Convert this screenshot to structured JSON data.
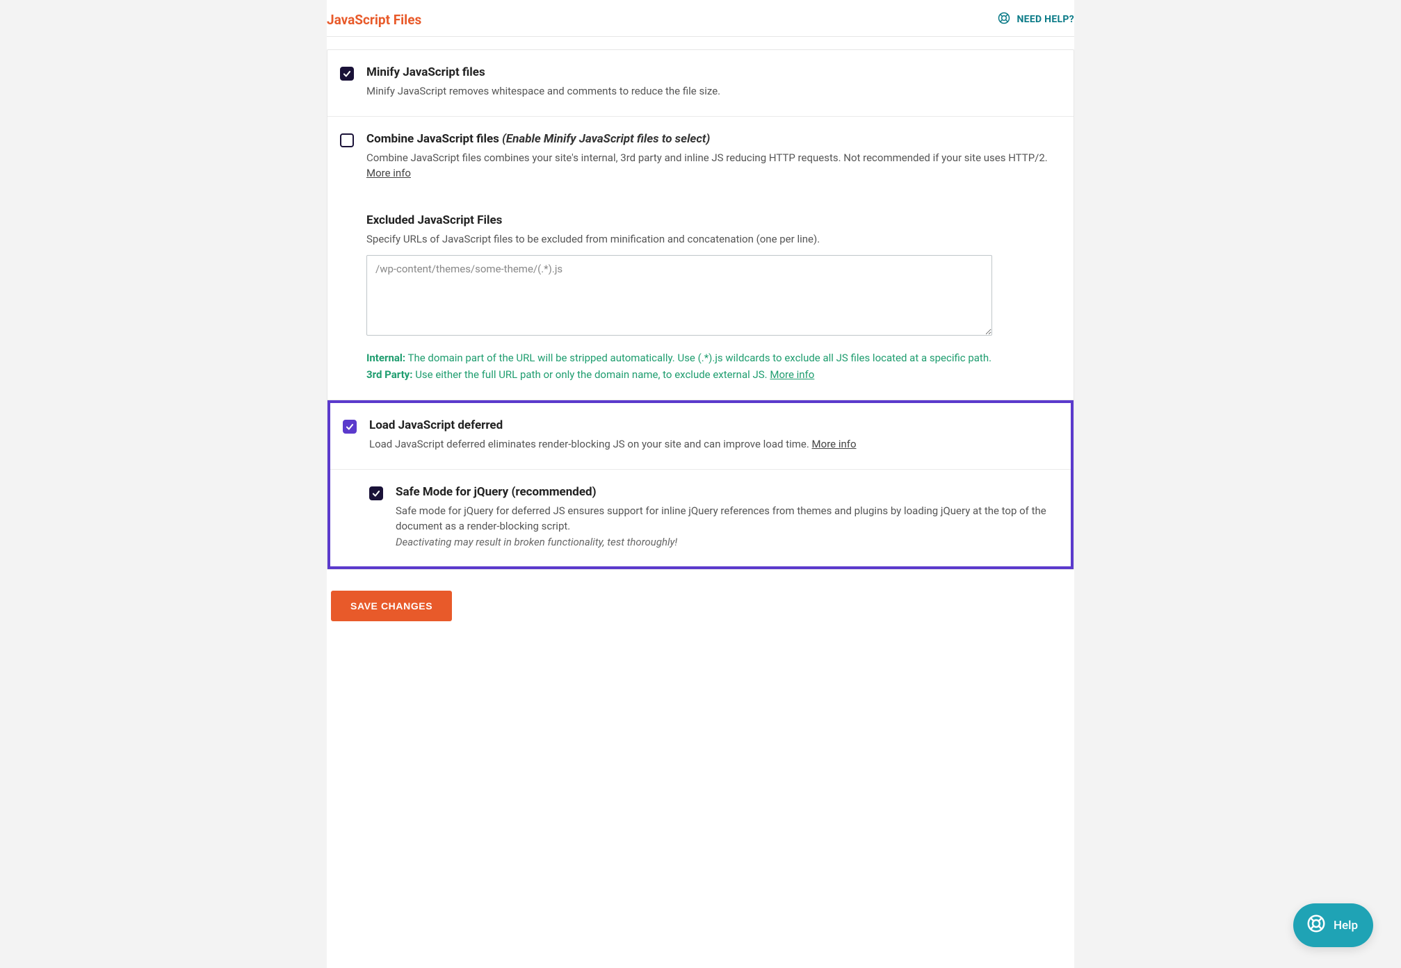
{
  "header": {
    "title": "JavaScript Files",
    "help": "NEED HELP?"
  },
  "options": {
    "minify": {
      "title": "Minify JavaScript files",
      "desc": "Minify JavaScript removes whitespace and comments to reduce the file size."
    },
    "combine": {
      "title": "Combine JavaScript files",
      "hint": "(Enable Minify JavaScript files to select)",
      "desc": "Combine JavaScript files combines your site's internal, 3rd party and inline JS reducing HTTP requests. Not recommended if your site uses HTTP/2.",
      "more": "More info"
    },
    "excluded": {
      "title": "Excluded JavaScript Files",
      "desc": "Specify URLs of JavaScript files to be excluded from minification and concatenation (one per line).",
      "placeholder": "/wp-content/themes/some-theme/(.*).js",
      "note_internal_label": "Internal:",
      "note_internal_text": " The domain part of the URL will be stripped automatically. Use (.*).js wildcards to exclude all JS files located at a specific path.",
      "note_3rd_label": "3rd Party:",
      "note_3rd_text": " Use either the full URL path or only the domain name, to exclude external JS. ",
      "note_more": "More info"
    },
    "defer": {
      "title": "Load JavaScript deferred",
      "desc": "Load JavaScript deferred eliminates render-blocking JS on your site and can improve load time. ",
      "more": "More info"
    },
    "safemode": {
      "title": "Safe Mode for jQuery (recommended)",
      "desc": "Safe mode for jQuery for deferred JS ensures support for inline jQuery references from themes and plugins by loading jQuery at the top of the document as a render-blocking script.",
      "warning": "Deactivating may result in broken functionality, test thoroughly!"
    }
  },
  "buttons": {
    "save": "SAVE CHANGES"
  },
  "floating": {
    "help": "Help"
  }
}
